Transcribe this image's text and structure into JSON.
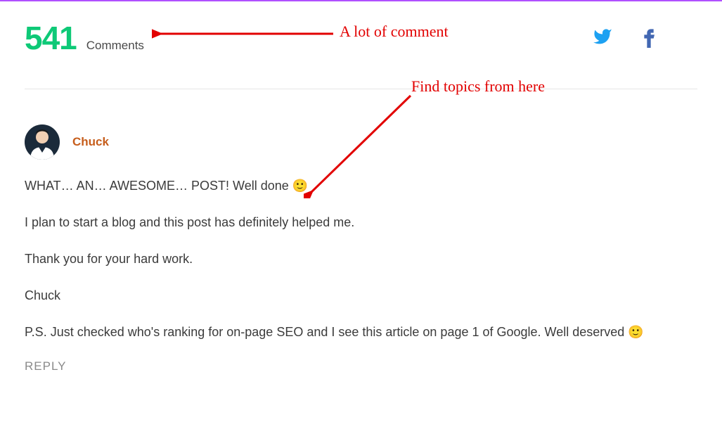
{
  "header": {
    "count": "541",
    "label": "Comments"
  },
  "social": {
    "twitter": "twitter",
    "facebook": "facebook"
  },
  "comment": {
    "author": "Chuck",
    "body": {
      "p1": "WHAT… AN… AWESOME… POST! Well done 🙂",
      "p2": "I plan to start a blog and this post has definitely helped me.",
      "p3": "Thank you for your hard work.",
      "p4": "Chuck",
      "p5": "P.S. Just checked who's ranking for on-page SEO and I see this article on page 1 of Google. Well deserved 🙂"
    },
    "reply": "REPLY"
  },
  "annotations": {
    "a1": "A lot of comment",
    "a2": "Find topics from here"
  }
}
